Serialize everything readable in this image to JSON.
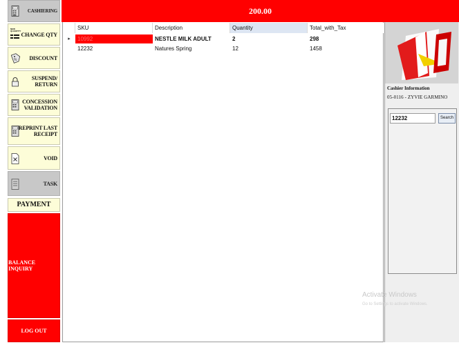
{
  "sidebar": {
    "cashiering": "CASHIERING",
    "change_qty_icon_text": "NEW\nQUANTITY",
    "change_qty": "CHANGE QTY",
    "discount": "DISCOUNT",
    "suspend_return": "SUSPEND/\nRETURN",
    "concession_validation": "CONCESSION\nVALIDATION",
    "reprint_last_receipt": "REPRINT LAST\nRECEIPT",
    "void": "VOID",
    "task": "TASK",
    "payment_method": "PAYMENT METHD",
    "balance_inquiry": "BALANCE INQUIRY",
    "log_out": "LOG OUT"
  },
  "total": "200.00",
  "grid": {
    "columns": [
      "SKU",
      "Description",
      "Quantity",
      "Total_with_Tax"
    ],
    "rows": [
      {
        "indicator": "▸",
        "sku": "10992",
        "description": "NESTLE MILK ADULT",
        "quantity": "2",
        "total": "298"
      },
      {
        "indicator": "",
        "sku": "12232",
        "description": "Natures Spring",
        "quantity": "12",
        "total": "1458"
      }
    ]
  },
  "cashier": {
    "title": "Cashier Information",
    "name": "05-0116 - ZYVIE GARMINO"
  },
  "search": {
    "value": "12232",
    "button": "Search"
  },
  "watermark": {
    "line1": "Activate Windows",
    "line2": "Go to Settings to activate Windows."
  },
  "colors": {
    "accent_red": "#ff0000",
    "button_cream": "#fdfdd8",
    "button_grey": "#c8c8c8"
  }
}
